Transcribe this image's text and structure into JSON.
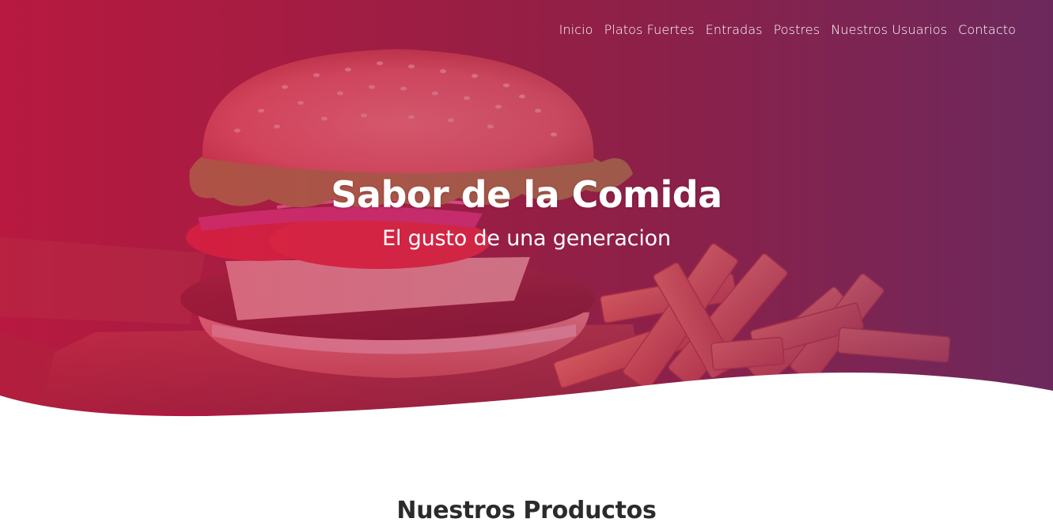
{
  "nav": {
    "items": [
      {
        "label": "Inicio"
      },
      {
        "label": "Platos Fuertes"
      },
      {
        "label": "Entradas"
      },
      {
        "label": "Postres"
      },
      {
        "label": "Nuestros Usuarios"
      },
      {
        "label": "Contacto"
      }
    ]
  },
  "hero": {
    "title": "Sabor de la Comida",
    "subtitle": "El gusto de una generacion",
    "overlay_color_left": "#c8173f",
    "overlay_color_right": "#7a2a6a"
  },
  "products": {
    "title": "Nuestros Productos"
  },
  "icons": [
    "burger-image",
    "fries-image"
  ]
}
